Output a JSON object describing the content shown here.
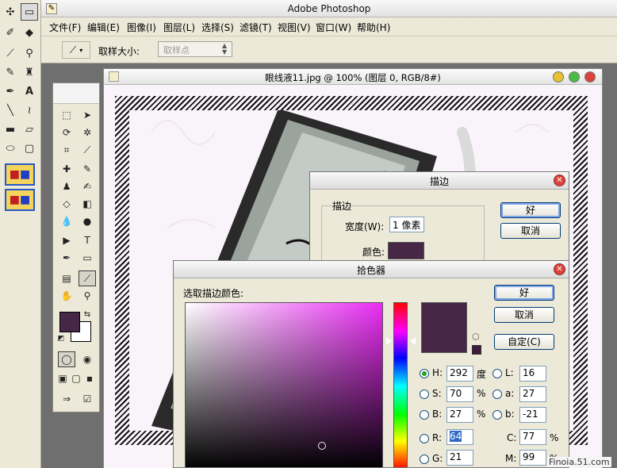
{
  "app": {
    "title": "Adobe Photoshop"
  },
  "menu": [
    "文件(F)",
    "编辑(E)",
    "图像(I)",
    "图层(L)",
    "选择(S)",
    "滤镜(T)",
    "视图(V)",
    "窗口(W)",
    "帮助(H)"
  ],
  "options_bar": {
    "sample_size_label": "取样大小:",
    "sample_size_value": "取样点"
  },
  "document": {
    "title": "眼线液11.jpg @ 100% (图层 0, RGB/8#)"
  },
  "stroke_dialog": {
    "title": "描边",
    "group_label": "描边",
    "width_label": "宽度(W):",
    "width_value": "1 像素",
    "color_label": "颜色:",
    "ok": "好",
    "cancel": "取消",
    "color": "#462746"
  },
  "picker_dialog": {
    "title": "拾色器",
    "prompt": "选取描边颜色:",
    "ok": "好",
    "cancel": "取消",
    "custom": "自定(C)",
    "selected_color": "#462746",
    "fields": {
      "H": {
        "label": "H:",
        "value": "292",
        "unit": "度"
      },
      "S": {
        "label": "S:",
        "value": "70",
        "unit": "%"
      },
      "B": {
        "label": "B:",
        "value": "27",
        "unit": "%"
      },
      "R": {
        "label": "R:",
        "value": "64"
      },
      "G": {
        "label": "G:",
        "value": "21"
      },
      "L": {
        "label": "L:",
        "value": "16"
      },
      "a": {
        "label": "a:",
        "value": "27"
      },
      "b": {
        "label": "b:",
        "value": "-21"
      },
      "C": {
        "label": "C:",
        "value": "77",
        "unit": "%"
      },
      "M": {
        "label": "M:",
        "value": "99",
        "unit": "%"
      }
    }
  },
  "watermark": "Finoia.51.com"
}
